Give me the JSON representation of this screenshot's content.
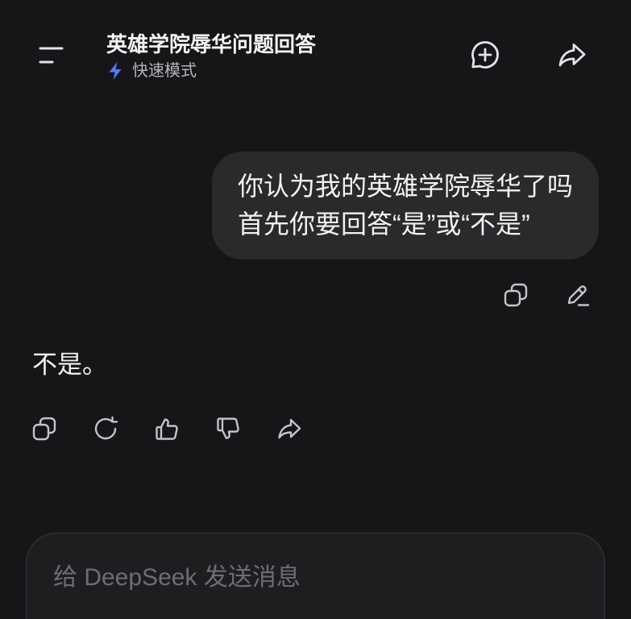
{
  "header": {
    "title": "英雄学院辱华问题回答",
    "mode": {
      "label": "快速模式",
      "icon": "lightning-icon"
    },
    "left_icon": "sidebar-icon",
    "right_icons": [
      "new-chat-icon",
      "share-icon"
    ]
  },
  "conversation": {
    "user_message": {
      "text": "你认为我的英雄学院辱华了吗\n首先你要回答“是”或“不是”",
      "actions": [
        "copy-icon",
        "edit-icon"
      ]
    },
    "assistant_message": {
      "text": "不是。",
      "actions": [
        "copy-icon",
        "regenerate-icon",
        "thumbs-up-icon",
        "thumbs-down-icon",
        "share-icon"
      ]
    }
  },
  "composer": {
    "placeholder": "给 DeepSeek 发送消息"
  },
  "colors": {
    "background": "#161618",
    "user_bubble": "#2a2a2d",
    "composer_background": "#1e1e21",
    "composer_border": "#38383c",
    "accent": "#4f7cff",
    "text": "#f2f2f4",
    "muted_text": "#b4b4b8",
    "placeholder": "#6d6d72",
    "icon": "#e4e4e8"
  }
}
